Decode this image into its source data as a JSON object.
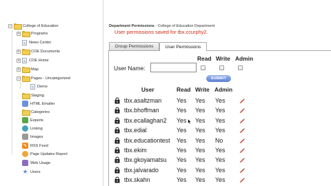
{
  "tree": {
    "items": [
      {
        "label": "College of Education",
        "icon": "folder-icon",
        "toggle": "−",
        "indent": 0
      },
      {
        "label": "Programs",
        "icon": "folder-icon",
        "toggle": "+",
        "indent": 1
      },
      {
        "label": "News Center",
        "icon": "page-icon",
        "toggle": "",
        "indent": 1
      },
      {
        "label": "COE Documents",
        "icon": "folder-icon",
        "toggle": "+",
        "indent": 1
      },
      {
        "label": "COE Home",
        "icon": "page-icon",
        "toggle": "+",
        "indent": 1
      },
      {
        "label": "Map",
        "icon": "folder-icon",
        "toggle": "+",
        "indent": 1
      },
      {
        "label": "Pages - Uncategorized",
        "icon": "folder-icon",
        "toggle": "−",
        "indent": 1
      },
      {
        "label": "Demo",
        "icon": "page-icon",
        "toggle": "",
        "indent": 2
      },
      {
        "label": "Staging",
        "icon": "folder-icon",
        "toggle": "",
        "indent": 1
      },
      {
        "label": "HTML Emailer",
        "icon": "html-emailer-icon",
        "toggle": "",
        "indent": 1
      },
      {
        "label": "Categories",
        "icon": "folder-icon",
        "toggle": "",
        "indent": 1
      },
      {
        "label": "Experts",
        "icon": "experts-icon",
        "toggle": "",
        "indent": 1
      },
      {
        "label": "Linking",
        "icon": "link-icon",
        "toggle": "",
        "indent": 1
      },
      {
        "label": "Images",
        "icon": "images-icon",
        "toggle": "",
        "indent": 1
      },
      {
        "label": "RSS Feed",
        "icon": "rss-icon",
        "toggle": "",
        "indent": 1
      },
      {
        "label": "Page Updates Report",
        "icon": "report-icon",
        "toggle": "",
        "indent": 1
      },
      {
        "label": "Web Usage",
        "icon": "chart-icon",
        "toggle": "",
        "indent": 1
      },
      {
        "label": "Users",
        "icon": "users-icon",
        "toggle": "",
        "indent": 1
      }
    ]
  },
  "main": {
    "heading_bold": "Department Permissions",
    "heading_rest": " - College of Education Department",
    "message": "User permissions saved for tbx.ccurphy2.",
    "tabs": [
      {
        "label": "Group Permissions",
        "active": false
      },
      {
        "label": "User Permissions",
        "active": true
      }
    ],
    "form": {
      "label": "User Name:",
      "input_value": "",
      "col_read": "Read",
      "col_write": "Write",
      "col_admin": "Admin",
      "submit": "SUBMIT"
    },
    "table": {
      "headers": {
        "user": "User",
        "read": "Read",
        "write": "Write",
        "admin": "Admin"
      },
      "rows": [
        {
          "user": "tbx.asaltzman",
          "read": "Yes",
          "write": "Yes",
          "admin": "Yes"
        },
        {
          "user": "tbx.bhoffman",
          "read": "Yes",
          "write": "Yes",
          "admin": "Yes"
        },
        {
          "user": "tbx.ecallaghan2",
          "read": "Yes",
          "write": "Yes",
          "admin": "Yes"
        },
        {
          "user": "tbx.edial",
          "read": "Yes",
          "write": "Yes",
          "admin": "Yes"
        },
        {
          "user": "tbx.educationtest",
          "read": "Yes",
          "write": "Yes",
          "admin": "No"
        },
        {
          "user": "tbx.ekim",
          "read": "Yes",
          "write": "Yes",
          "admin": "Yes"
        },
        {
          "user": "tbx.gkoyamatsu",
          "read": "Yes",
          "write": "Yes",
          "admin": "Yes"
        },
        {
          "user": "tbx.jalvarado",
          "read": "Yes",
          "write": "Yes",
          "admin": "Yes"
        },
        {
          "user": "tbx.skahn",
          "read": "Yes",
          "write": "Yes",
          "admin": "Yes"
        }
      ]
    }
  },
  "colors": {
    "message": "#cc2a12",
    "folder": "#f2cf52",
    "submit": "#5b7fd1",
    "pencil": "#c0392b"
  }
}
